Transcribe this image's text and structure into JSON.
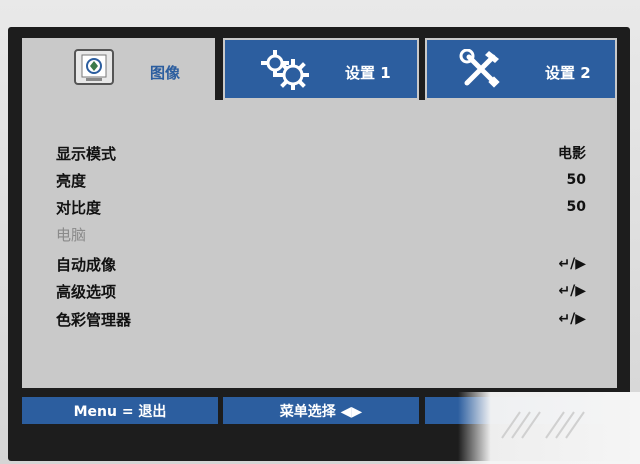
{
  "tabs": [
    {
      "label": "图像",
      "icon": "image-icon",
      "active": true
    },
    {
      "label": "设置 1",
      "icon": "gears-icon",
      "active": false
    },
    {
      "label": "设置 2",
      "icon": "tools-icon",
      "active": false
    }
  ],
  "menu": [
    {
      "label": "显示模式",
      "value": "电影"
    },
    {
      "label": "亮度",
      "value": "50"
    },
    {
      "label": "对比度",
      "value": "50"
    },
    {
      "label": "电脑",
      "value": "",
      "disabled": true
    },
    {
      "label": "自动成像",
      "value": "↵/▶"
    },
    {
      "label": "高级选项",
      "value": "↵/▶"
    },
    {
      "label": "色彩管理器",
      "value": "↵/▶"
    }
  ],
  "footer": {
    "exit": "Menu = 退出",
    "select": "菜单选择 ◀▶"
  },
  "colors": {
    "accent": "#2c5e9f",
    "panel": "#c9c9c9",
    "frame": "#1d1d1d"
  }
}
